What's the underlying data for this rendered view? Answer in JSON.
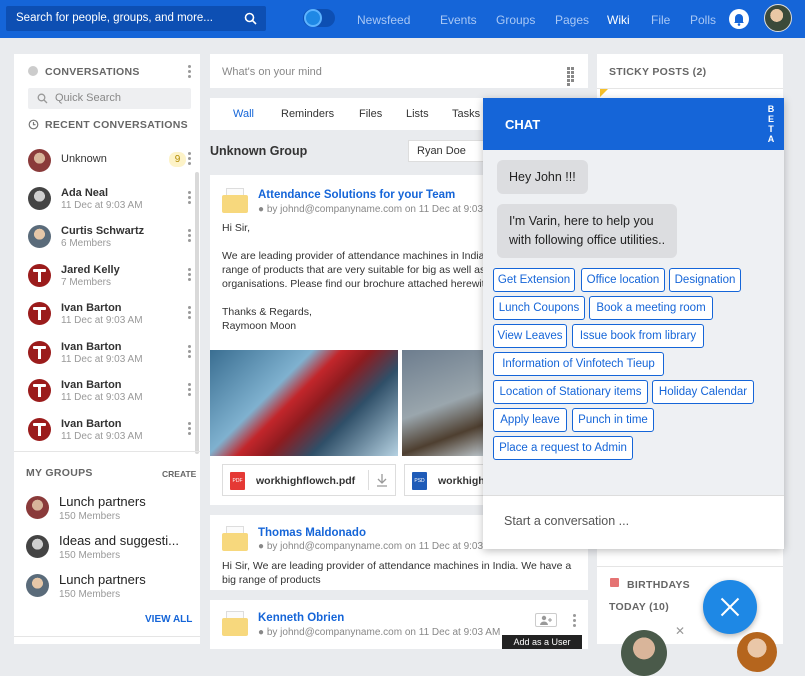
{
  "topbar": {
    "search_placeholder": "Search for people, groups, and more...",
    "nav": [
      "Newsfeed",
      "Events",
      "Groups",
      "Pages",
      "Wiki",
      "File",
      "Polls"
    ],
    "active_nav": "Wiki"
  },
  "left": {
    "conversations_title": "CONVERSATIONS",
    "quick_search": "Quick Search",
    "recent_title": "RECENT CONVERSATIONS",
    "conversations": [
      {
        "name": "Unknown",
        "sub": "",
        "badge": "9"
      },
      {
        "name": "Ada Neal",
        "sub": "11 Dec at 9:03 AM"
      },
      {
        "name": "Curtis Schwartz",
        "sub": "6 Members"
      },
      {
        "name": "Jared Kelly",
        "sub": "7 Members"
      },
      {
        "name": "Ivan Barton",
        "sub": "11 Dec at 9:03 AM"
      },
      {
        "name": "Ivan Barton",
        "sub": "11 Dec at 9:03 AM"
      },
      {
        "name": "Ivan Barton",
        "sub": "11 Dec at 9:03 AM"
      },
      {
        "name": "Ivan Barton",
        "sub": "11 Dec at 9:03 AM"
      }
    ],
    "my_groups_title": "MY GROUPS",
    "create_label": "CREATE",
    "groups": [
      {
        "name": "Lunch partners",
        "sub": "150 Members"
      },
      {
        "name": "Ideas and suggesti...",
        "sub": "150 Members"
      },
      {
        "name": "Lunch partners",
        "sub": "150 Members"
      }
    ],
    "view_all": "VIEW ALL"
  },
  "center": {
    "compose_placeholder": "What's on your mind",
    "tabs": [
      "Wall",
      "Reminders",
      "Files",
      "Lists",
      "Tasks"
    ],
    "active_tab": "Wall",
    "group_name": "Unknown Group",
    "member_select": "Ryan Doe",
    "posts": [
      {
        "title": "Attendance Solutions for your Team",
        "meta_prefix": "by",
        "author": "johnd@companyname.com",
        "meta_date": "on 11 Dec at 9:03 AM",
        "body_lines": [
          "Hi Sir,",
          "",
          "We are leading provider of attendance machines in India",
          "range of products that are very suitable for big as well as",
          "organisations. Please find our brochure attached herewit",
          "",
          "Thanks & Regards,",
          "Raymoon Moon"
        ],
        "files": [
          {
            "name": "workhighflowch.pdf",
            "type": "PDF",
            "color": "#e53935"
          },
          {
            "name": "workhigh",
            "type": "PSD",
            "color": "#1e5bb8"
          }
        ]
      },
      {
        "title": "Thomas Maldonado",
        "meta_prefix": "by",
        "author": "johnd@companyname.com",
        "meta_date": "on 11 Dec at 9:03 AM",
        "body_lines": [
          "Hi Sir, We are leading provider of attendance machines in India. We have a",
          "big range of products"
        ]
      },
      {
        "title": "Kenneth Obrien",
        "meta_prefix": "by",
        "author": "johnd@companyname.com",
        "meta_date": "on 11 Dec at 9:03 AM"
      }
    ],
    "tooltip": "Add as a User"
  },
  "right": {
    "sticky_title": "STICKY POSTS",
    "sticky_count": "(2)",
    "birthdays_title": "BIRTHDAYS",
    "today_title": "TODAY (10)"
  },
  "chat": {
    "title": "CHAT",
    "beta": [
      "B",
      "E",
      "T",
      "A"
    ],
    "messages": [
      "Hey John !!!",
      "I'm Varin, here to help you",
      "with following office utilities.."
    ],
    "options": [
      "Get Extension",
      "Office location",
      "Designation",
      "Lunch Coupons",
      "Book a meeting room",
      "View Leaves",
      "Issue book from library",
      "Information of Vinfotech Tieup",
      "Location of Stationary items",
      "Holiday Calendar",
      "Apply leave",
      "Punch in time",
      "Place a request to Admin"
    ],
    "input_placeholder": "Start a conversation ...",
    "accent": "#1565d8"
  }
}
